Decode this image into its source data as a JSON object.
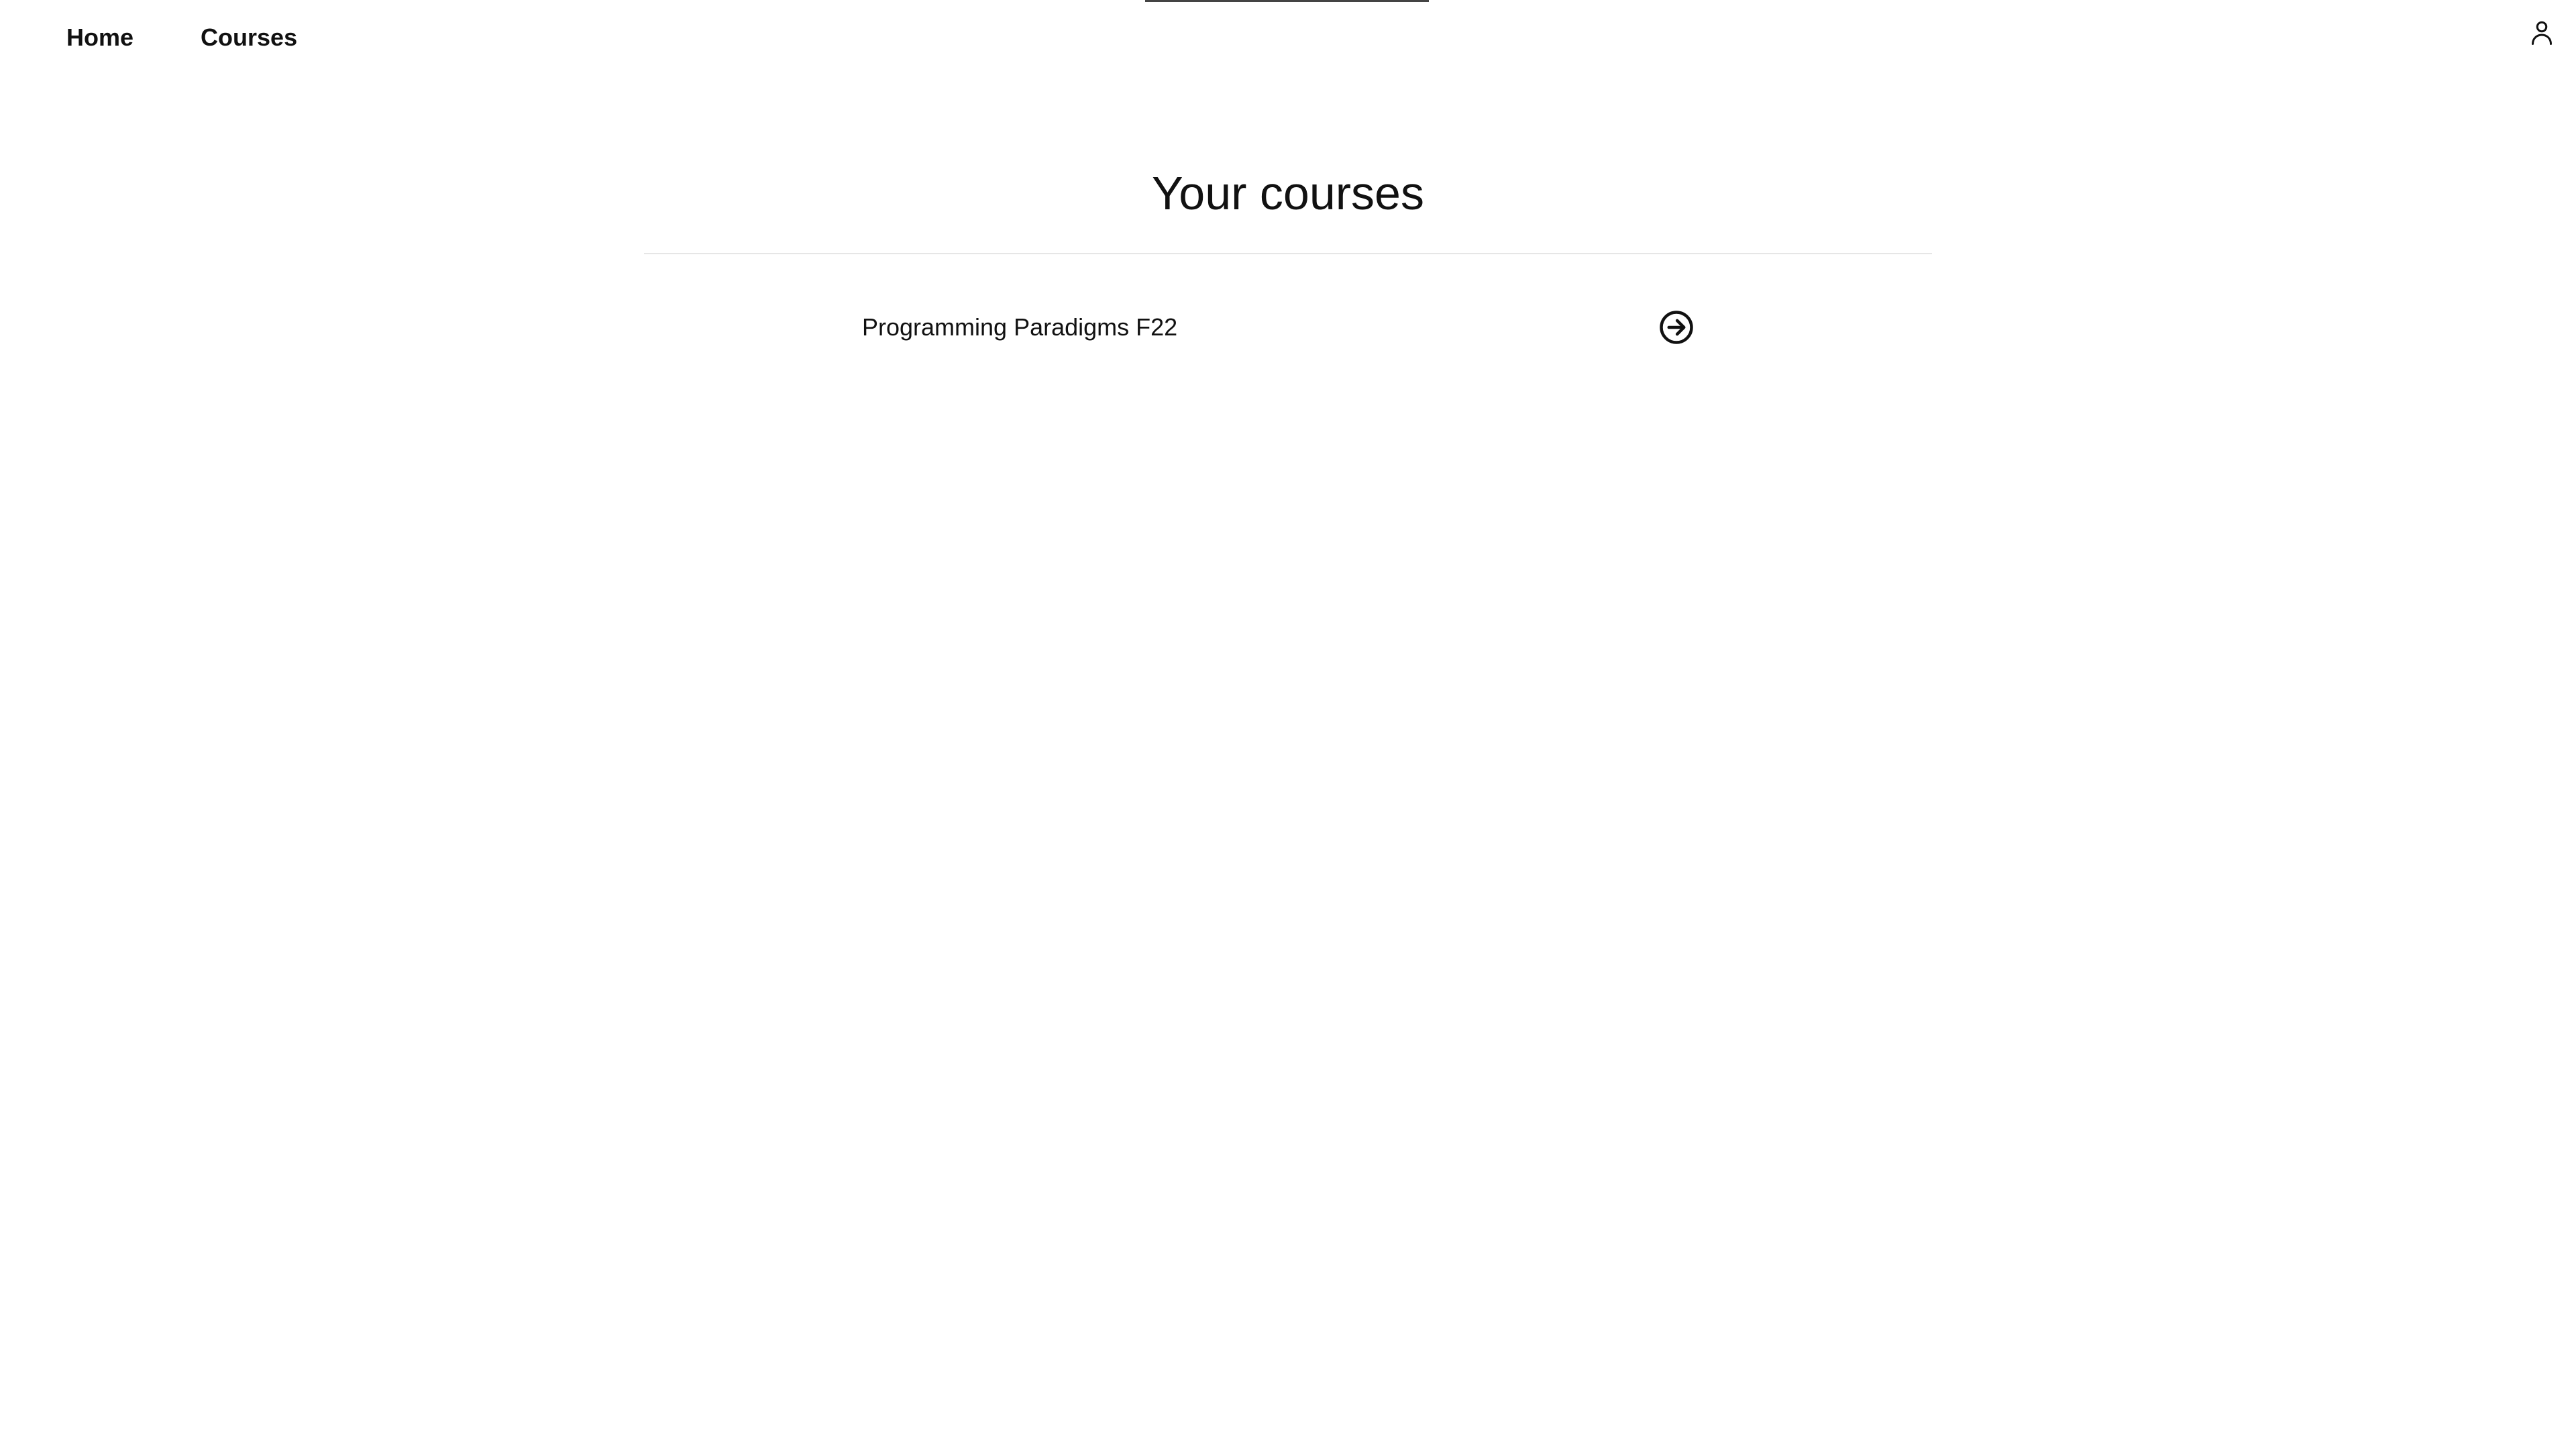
{
  "navbar": {
    "links": [
      {
        "label": "Home"
      },
      {
        "label": "Courses"
      }
    ],
    "user_icon": "user-icon"
  },
  "main": {
    "title": "Your courses",
    "courses": [
      {
        "name": "Programming Paradigms F22",
        "action_icon": "arrow-right-circle-icon"
      }
    ]
  },
  "colors": {
    "text": "#111111",
    "divider": "#e6e6e6",
    "top_indicator": "#444444",
    "background": "#ffffff"
  }
}
